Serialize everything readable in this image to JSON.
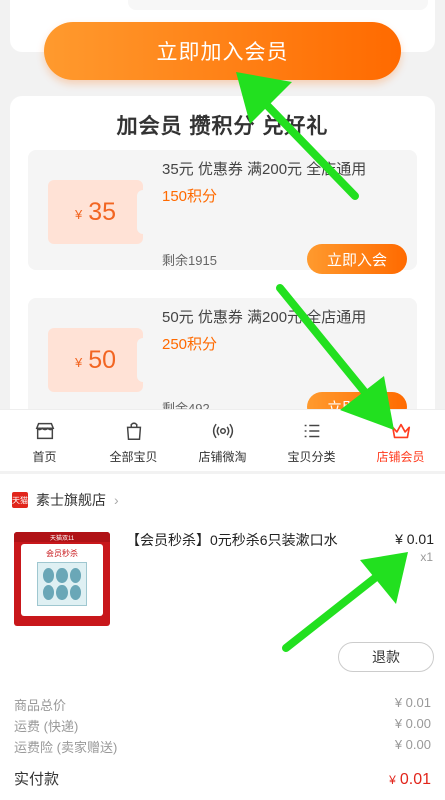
{
  "top": {
    "join_button": "立即加入会员"
  },
  "panel": {
    "title": "加会员 攒积分 兑好礼",
    "coupons": [
      {
        "currency": "¥",
        "amount": "35",
        "desc": "35元 优惠券 满200元 全店通用",
        "points": "150积分",
        "remain": "剩余1915",
        "button": "立即入会"
      },
      {
        "currency": "¥",
        "amount": "50",
        "desc": "50元 优惠券 满200元 全店通用",
        "points": "250积分",
        "remain": "剩余492",
        "button": "立即入会"
      }
    ]
  },
  "tabbar": {
    "items": [
      {
        "label": "首页",
        "icon": "store-icon"
      },
      {
        "label": "全部宝贝",
        "icon": "shopping-bag-icon"
      },
      {
        "label": "店铺微淘",
        "icon": "broadcast-icon"
      },
      {
        "label": "宝贝分类",
        "icon": "list-icon"
      },
      {
        "label": "店铺会员",
        "icon": "crown-icon",
        "active": true
      }
    ]
  },
  "order": {
    "shop_badge": "天猫",
    "shop_name": "素士旗舰店",
    "product_image": {
      "top_text": "天猫双11",
      "title": "会员秒杀"
    },
    "product_title": "【会员秒杀】0元秒杀6只装漱口水",
    "price": "¥ 0.01",
    "quantity": "x1",
    "refund_button": "退款",
    "summary": [
      {
        "label": "商品总价",
        "value": "¥ 0.01"
      },
      {
        "label": "运费 (快递)",
        "value": "¥ 0.00"
      },
      {
        "label": "运费险 (卖家赠送)",
        "value": "¥ 0.00"
      }
    ],
    "total_label": "实付款",
    "total_currency": "¥",
    "total_value": "0.01"
  },
  "colors": {
    "accent": "#ff6a00",
    "active_tab": "#ff3c1f",
    "price_red": "#e1251b",
    "annotation_green": "#22e01f"
  }
}
